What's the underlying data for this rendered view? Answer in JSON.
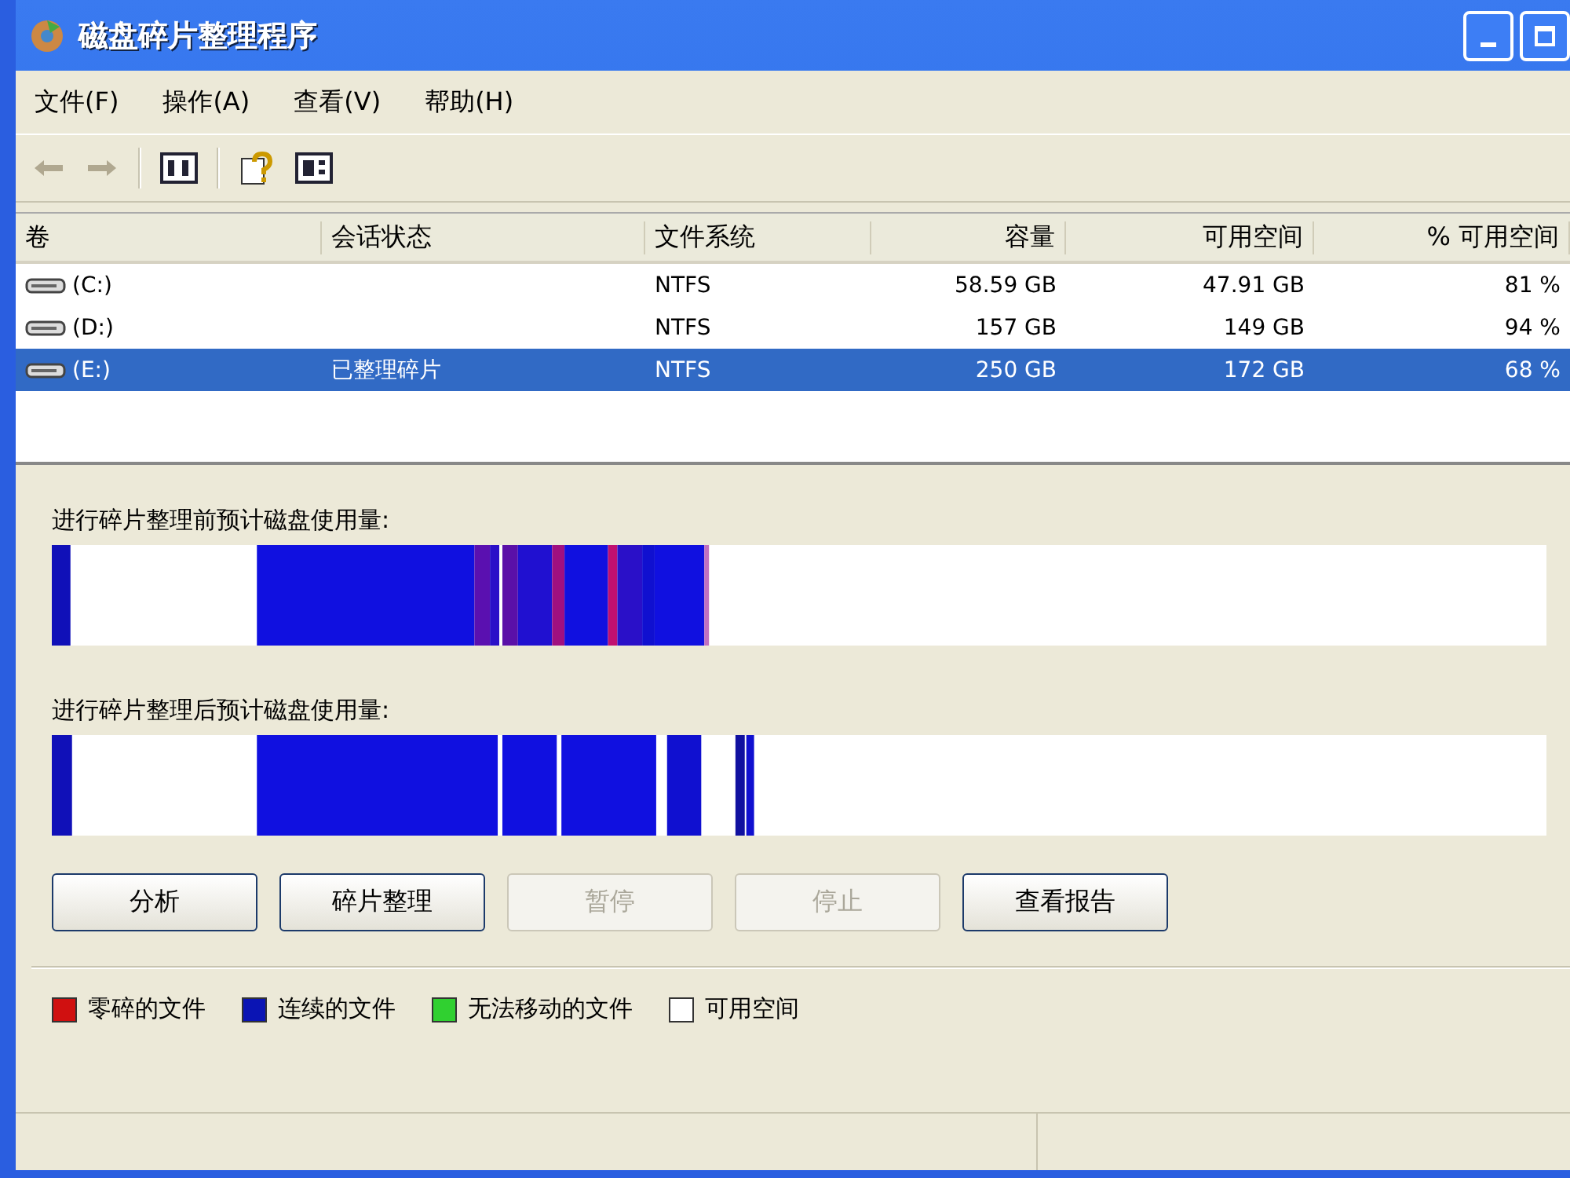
{
  "window": {
    "title": "磁盘碎片整理程序"
  },
  "menu": [
    {
      "label": "文件(F)"
    },
    {
      "label": "操作(A)"
    },
    {
      "label": "查看(V)"
    },
    {
      "label": "帮助(H)"
    }
  ],
  "volumes": {
    "columns": [
      {
        "label": "卷"
      },
      {
        "label": "会话状态"
      },
      {
        "label": "文件系统"
      },
      {
        "label": "容量"
      },
      {
        "label": "可用空间"
      },
      {
        "label": "% 可用空间"
      }
    ],
    "rows": [
      {
        "cells": [
          "(C:)",
          "",
          "NTFS",
          "58.59 GB",
          "47.91 GB",
          "81 %"
        ],
        "selected": false
      },
      {
        "cells": [
          "(D:)",
          "",
          "NTFS",
          "157 GB",
          "149 GB",
          "94 %"
        ],
        "selected": false
      },
      {
        "cells": [
          "(E:)",
          "已整理碎片",
          "NTFS",
          "250 GB",
          "172 GB",
          "68 %"
        ],
        "selected": true
      }
    ]
  },
  "maps": [
    {
      "label": "进行碎片整理前预计磁盘使用量:"
    },
    {
      "label": "进行碎片整理后预计磁盘使用量:"
    }
  ],
  "buttons": [
    {
      "label": "分析",
      "disabled": false
    },
    {
      "label": "碎片整理",
      "disabled": false
    },
    {
      "label": "暂停",
      "disabled": true
    },
    {
      "label": "停止",
      "disabled": true
    },
    {
      "label": "查看报告",
      "disabled": false
    }
  ],
  "legend": [
    {
      "label": "零碎的文件",
      "color": "#d01010"
    },
    {
      "label": "连续的文件",
      "color": "#0a14b4"
    },
    {
      "label": "无法移动的文件",
      "color": "#30d030"
    },
    {
      "label": "可用空间",
      "color": "#ffffff"
    }
  ]
}
